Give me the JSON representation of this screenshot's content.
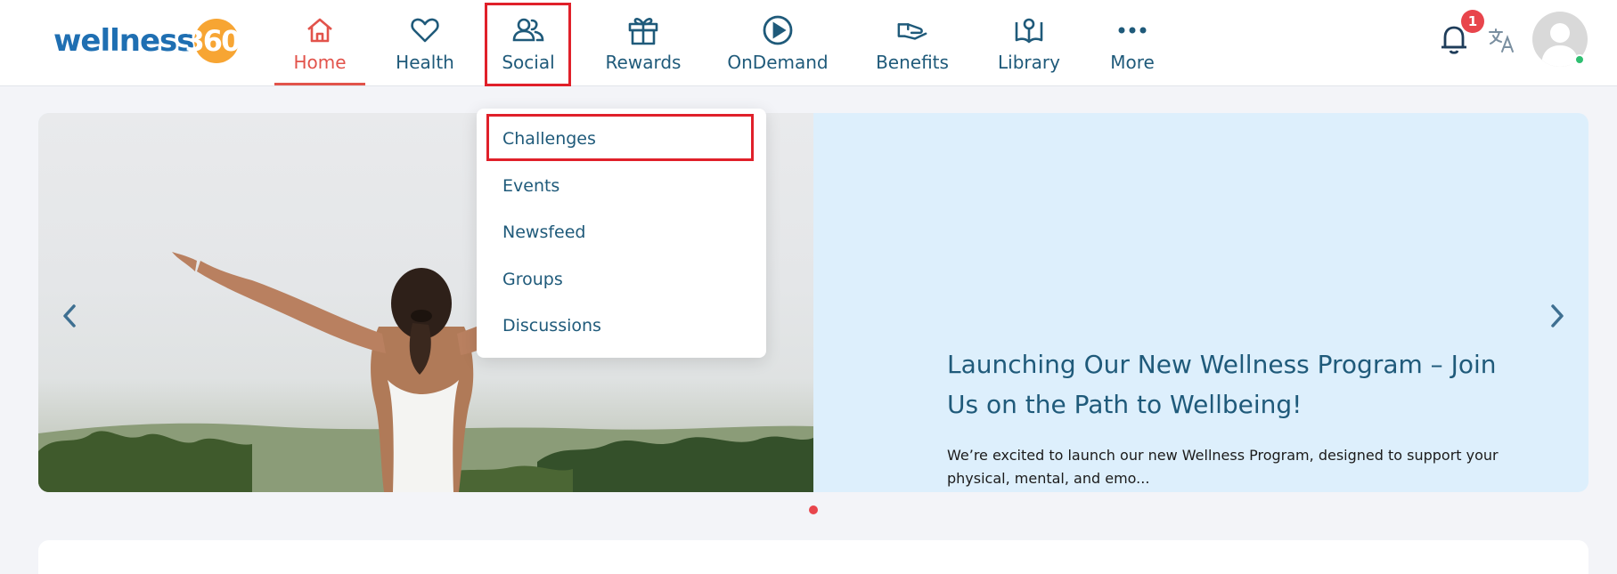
{
  "brand": {
    "logo_word": "wellness",
    "logo_number": "360"
  },
  "nav": {
    "items": [
      {
        "label": "Home",
        "icon": "home-icon",
        "active": true
      },
      {
        "label": "Health",
        "icon": "heart-icon"
      },
      {
        "label": "Social",
        "icon": "users-icon"
      },
      {
        "label": "Rewards",
        "icon": "gift-icon"
      },
      {
        "label": "OnDemand",
        "icon": "play-circle-icon"
      },
      {
        "label": "Benefits",
        "icon": "hand-icon"
      },
      {
        "label": "Library",
        "icon": "book-icon"
      },
      {
        "label": "More",
        "icon": "more-dots-icon"
      }
    ]
  },
  "notifications": {
    "count": "1"
  },
  "social_menu": {
    "items": [
      "Challenges",
      "Events",
      "Newsfeed",
      "Groups",
      "Discussions"
    ]
  },
  "hero": {
    "title": "Launching Our New Wellness Program – Join Us on the Path to Wellbeing!",
    "description": "We’re excited to launch our new Wellness Program, designed to support your physical, mental, and emo..."
  },
  "colors": {
    "accent": "#e2534b",
    "primary_text": "#1f5a7a",
    "highlight": "#e0202a",
    "slide_bg": "#ddeffc"
  }
}
